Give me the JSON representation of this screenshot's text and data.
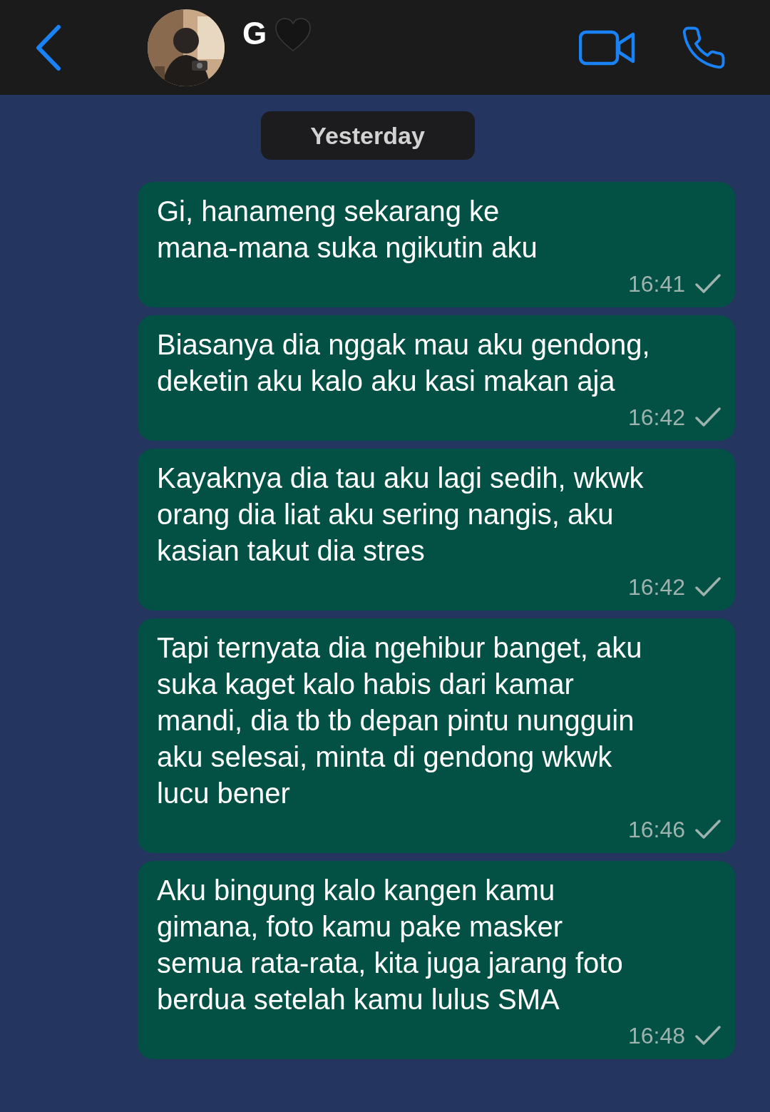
{
  "header": {
    "contact_name": "G"
  },
  "date_separator": "Yesterday",
  "messages": [
    {
      "text": "Gi, hanameng sekarang ke\nmana-mana suka ngikutin aku",
      "time": "16:41"
    },
    {
      "text": "Biasanya dia nggak mau aku gendong,\ndeketin aku kalo aku kasi makan aja",
      "time": "16:42"
    },
    {
      "text": "Kayaknya dia tau aku lagi sedih, wkwk\norang dia liat aku sering nangis, aku\nkasian takut dia stres",
      "time": "16:42"
    },
    {
      "text": "Tapi ternyata dia ngehibur banget, aku\nsuka kaget kalo habis dari kamar\nmandi, dia tb tb depan pintu nungguin\naku selesai, minta di gendong wkwk\nlucu bener",
      "time": "16:46"
    },
    {
      "text": "Aku bingung kalo kangen kamu\ngimana, foto kamu pake masker\nsemua rata-rata, kita juga jarang foto\nberdua setelah kamu lulus SMA",
      "time": "16:48"
    }
  ]
}
